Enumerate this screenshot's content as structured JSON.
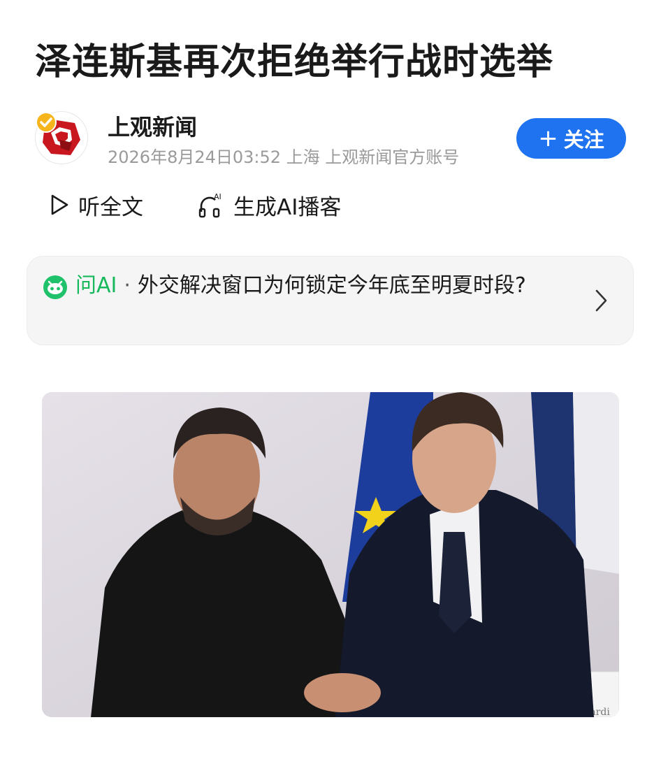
{
  "article": {
    "title": "泽连斯基再次拒绝举行战时选举"
  },
  "author": {
    "name": "上观新闻",
    "meta": "2026年8月24日03:52 上海 上观新闻官方账号",
    "follow_label": "关注",
    "follow_plus": "+"
  },
  "actions": {
    "listen_label": "听全文",
    "podcast_label": "生成AI播客",
    "podcast_badge": "AI"
  },
  "ask_ai": {
    "brand": "问AI",
    "separator": "·",
    "question": "外交解决窗口为何锁定今年底至明夏时段?"
  },
  "colors": {
    "follow_bg": "#1f73f0",
    "ai_green": "#16b85c",
    "meta_gray": "#9a9a9a"
  },
  "icons": {
    "listen": "play-outline-icon",
    "podcast": "headphones-ai-icon",
    "ask_ai": "ai-bot-icon",
    "chevron": "chevron-right-icon"
  },
  "photo": {
    "flag_text": "Mardi"
  }
}
